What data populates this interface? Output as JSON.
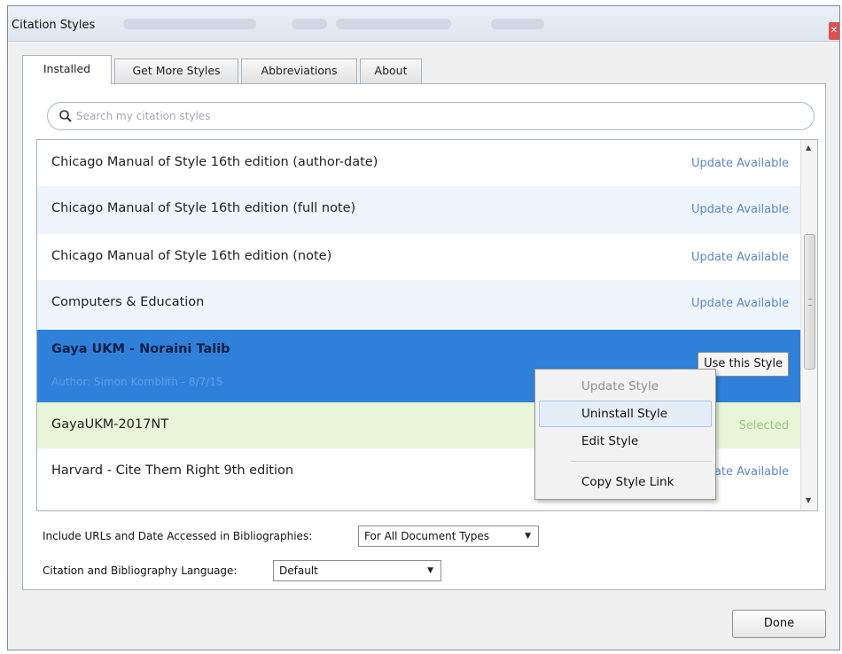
{
  "window": {
    "title": "Citation Styles"
  },
  "tabs": [
    {
      "label": "Installed"
    },
    {
      "label": "Get More Styles"
    },
    {
      "label": "Abbreviations"
    },
    {
      "label": "About"
    }
  ],
  "search": {
    "placeholder": "Search my citation styles"
  },
  "styles": [
    {
      "name": "Chicago Manual of Style 16th edition (author-date)",
      "status": "Update Available"
    },
    {
      "name": "Chicago Manual of Style 16th edition (full note)",
      "status": "Update Available"
    },
    {
      "name": "Chicago Manual of Style 16th edition (note)",
      "status": "Update Available"
    },
    {
      "name": "Computers & Education",
      "status": "Update Available"
    },
    {
      "name": "Gaya UKM - Noraini Talib",
      "author": "Author: Simon Kornblith - 8/7/15",
      "button": "Use this Style"
    },
    {
      "name": "GayaUKM-2017NT",
      "status": "Selected"
    },
    {
      "name": "Harvard - Cite Them Right 9th edition",
      "status": "Update Available"
    }
  ],
  "context_menu": {
    "items": [
      {
        "label": "Update Style",
        "disabled": true
      },
      {
        "label": "Uninstall Style"
      },
      {
        "label": "Edit Style"
      },
      {
        "label": "Copy Style Link"
      }
    ]
  },
  "options": {
    "urls_label": "Include URLs and Date Accessed in Bibliographies:",
    "urls_value": "For All Document Types",
    "language_label": "Citation and Bibliography Language:",
    "language_value": "Default"
  },
  "footer": {
    "done_label": "Done"
  },
  "colors": {
    "selected_row": "#2f80d8",
    "link_status": "#5b87c8",
    "selected_style_row": "#e8f5d8"
  }
}
